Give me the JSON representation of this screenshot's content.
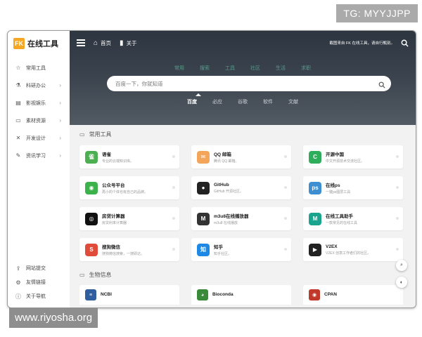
{
  "watermarks": {
    "top": "TG: MYYJJPP",
    "bottom": "www.riyosha.org"
  },
  "sidebar": {
    "logo_mark": "FK",
    "logo_text": "在线工具",
    "items": [
      {
        "label": "常用工具",
        "icon": "star-icon",
        "arrow": false
      },
      {
        "label": "科研办公",
        "icon": "flask-icon",
        "arrow": true
      },
      {
        "label": "影视娱乐",
        "icon": "film-icon",
        "arrow": true
      },
      {
        "label": "素材资源",
        "icon": "folder-icon",
        "arrow": true
      },
      {
        "label": "开发设计",
        "icon": "tools-icon",
        "arrow": true
      },
      {
        "label": "资讯学习",
        "icon": "pencil-icon",
        "arrow": true
      }
    ],
    "bottom_items": [
      {
        "label": "网站提交",
        "icon": "upload-icon"
      },
      {
        "label": "友情链接",
        "icon": "link-icon"
      },
      {
        "label": "关于导航",
        "icon": "info-icon"
      }
    ]
  },
  "topbar": {
    "home_label": "首页",
    "about_label": "关于",
    "announcement": "截图来自 FK 在线工具，请自行甄别。"
  },
  "hero": {
    "category_tabs": [
      "常用",
      "搜索",
      "工具",
      "社区",
      "生活",
      "求职"
    ],
    "search_placeholder": "百度一下，你就知道",
    "engines": [
      "百度",
      "必应",
      "谷歌",
      "软件",
      "文献"
    ],
    "active_engine": "百度"
  },
  "section_common": {
    "title": "常用工具",
    "cards": [
      {
        "name": "语雀",
        "desc": "专业的云端知识库。",
        "color": "#4caf50",
        "glyph": "雀"
      },
      {
        "name": "QQ 邮箱",
        "desc": "腾讯 QQ 邮箱。",
        "color": "#f3a55a",
        "glyph": "✉"
      },
      {
        "name": "开源中国",
        "desc": "中文开源技术交流社区。",
        "color": "#2eae5a",
        "glyph": "C"
      },
      {
        "name": "公众号平台",
        "desc": "再小的个体也有自己的品牌。",
        "color": "#3bb34a",
        "glyph": "◉"
      },
      {
        "name": "GitHub",
        "desc": "GitHub 开源社区。",
        "color": "#222222",
        "glyph": "●"
      },
      {
        "name": "在线ps",
        "desc": "一键ps图层工具",
        "color": "#3d8fd1",
        "glyph": "ps"
      },
      {
        "name": "房贷计算器",
        "desc": "房贷利率计算器",
        "color": "#111111",
        "glyph": "◎"
      },
      {
        "name": "m3u8在线播放器",
        "desc": "m3u8 在线播放",
        "color": "#333333",
        "glyph": "M"
      },
      {
        "name": "在线工具助手",
        "desc": "一款常见的在线工具",
        "color": "#1aa38d",
        "glyph": "M"
      },
      {
        "name": "搜狗微信",
        "desc": "搜狗微信搜索，一搜即达。",
        "color": "#e04b3a",
        "glyph": "S"
      },
      {
        "name": "知乎",
        "desc": "知乎社区。",
        "color": "#1e88e5",
        "glyph": "知"
      },
      {
        "name": "V2EX",
        "desc": "V2EX 创意工作者们的社区。",
        "color": "#222222",
        "glyph": "▶"
      }
    ]
  },
  "section_bio": {
    "title": "生物信息",
    "cards": [
      {
        "name": "NCBI",
        "color": "#2f5f9e",
        "glyph": "≡"
      },
      {
        "name": "Bioconda",
        "color": "#3a8a3a",
        "glyph": "◕"
      },
      {
        "name": "CPAN",
        "color": "#c0392b",
        "glyph": "◉"
      }
    ]
  },
  "fab": {
    "search_icon": "search-icon",
    "theme_icon": "moon-icon"
  }
}
